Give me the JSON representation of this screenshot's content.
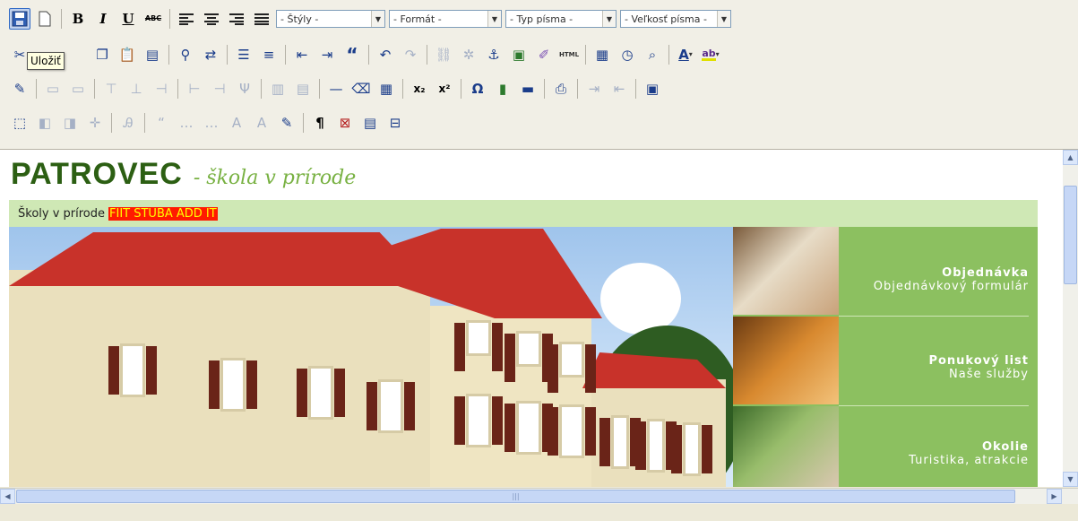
{
  "toolbar": {
    "styles": "- Štýly -",
    "format": "- Formát -",
    "font": "- Typ písma -",
    "font_size": "- Veľkosť písma -",
    "tooltip": "Uložiť",
    "bold": "B",
    "italic": "I",
    "underline": "U",
    "strike": "ABC",
    "html": "HTML",
    "quote": "“",
    "subscript": "x₂",
    "superscript": "x²",
    "omega": "Ω",
    "pilcrow": "¶",
    "text_color": "A",
    "bg_color": "ab"
  },
  "page": {
    "brand": "PATROVEC",
    "subtitle": "- škola v prírode",
    "nav_text": "Školy v prírode",
    "nav_highlight": "FIIT STUBA ADD IT"
  },
  "sidebar": {
    "items": [
      {
        "title": "Objednávka",
        "subtitle": "Objednávkový formulár"
      },
      {
        "title": "Ponukový list",
        "subtitle": "Naše služby"
      },
      {
        "title": "Okolie",
        "subtitle": "Turistika, atrakcie"
      }
    ]
  },
  "colors": {
    "brand": "#2c5f13",
    "subtitle": "#78b142",
    "navbar": "#cfe8b5",
    "sidebar": "#8cc060",
    "highlight_bg": "#ff1a00",
    "highlight_fg": "#ffff00",
    "roof": "#c8322a",
    "wall": "#eae0bd"
  },
  "icons": [
    "save-icon",
    "new-document-icon",
    "cut-icon",
    "copy-icon",
    "paste-icon",
    "find-icon",
    "replace-icon",
    "bullet-list-icon",
    "numbered-list-icon",
    "outdent-icon",
    "indent-icon",
    "blockquote-icon",
    "undo-icon",
    "redo-icon",
    "link-icon",
    "unlink-icon",
    "anchor-icon",
    "image-icon",
    "cleanup-icon",
    "html-icon",
    "date-icon",
    "time-icon",
    "preview-icon",
    "text-color-icon",
    "highlight-color-icon",
    "table-icon",
    "horizontal-rule-icon",
    "eraser-icon",
    "subscript-icon",
    "superscript-icon",
    "special-char-icon",
    "media-icon",
    "print-icon",
    "fullscreen-icon",
    "pilcrow-icon"
  ]
}
